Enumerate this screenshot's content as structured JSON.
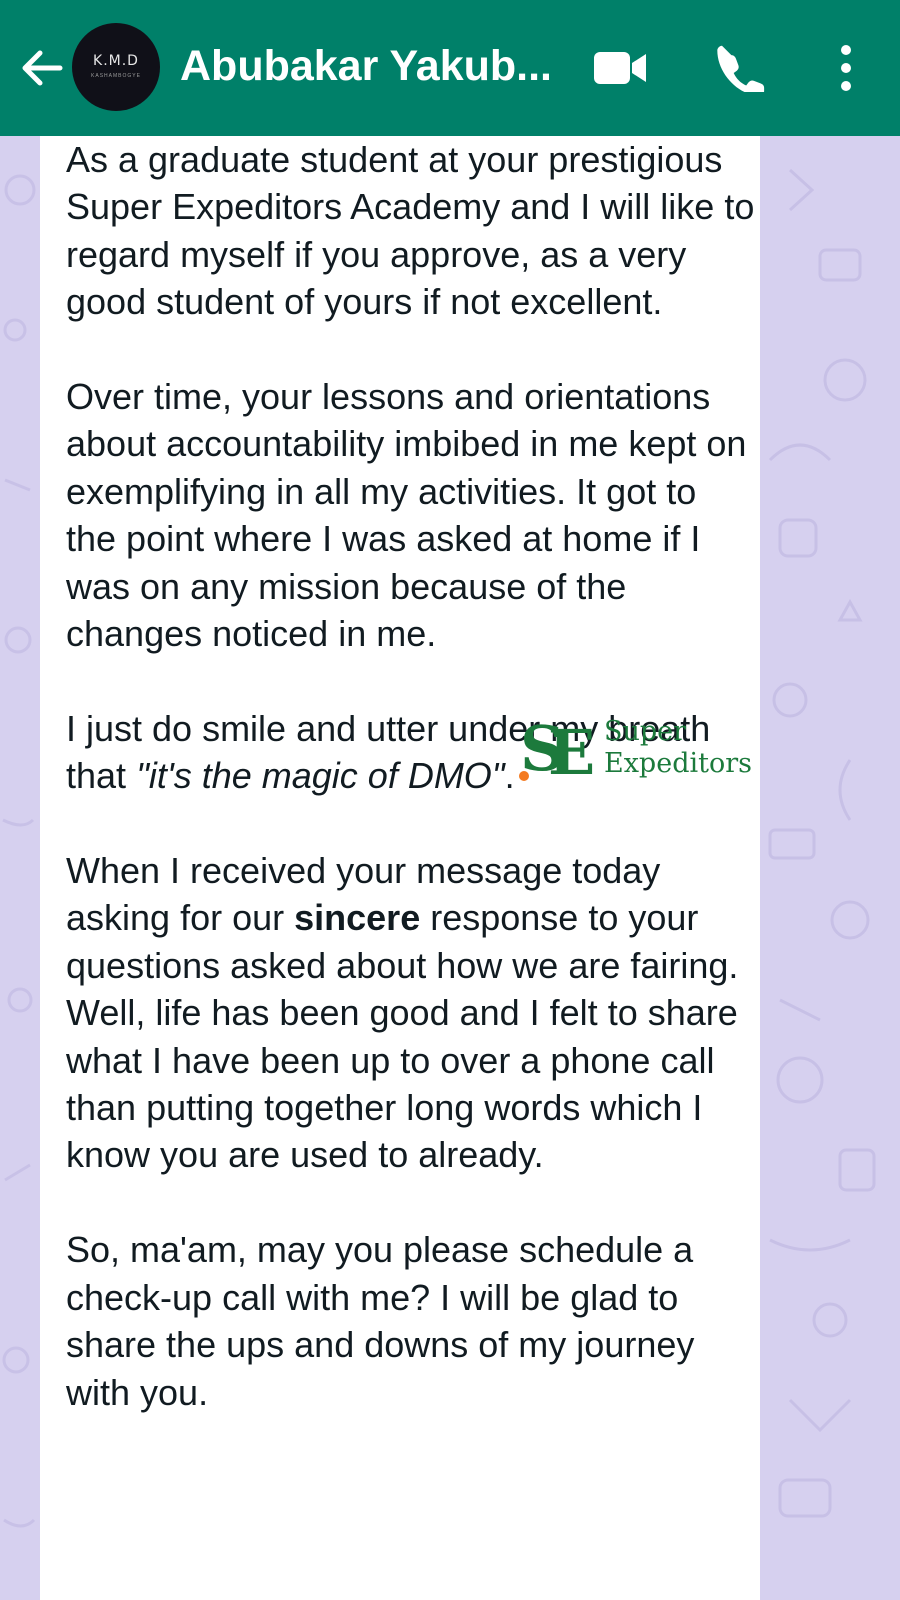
{
  "header": {
    "contact_name": "Abubakar Yakub...",
    "avatar_text": "K.M.D",
    "avatar_subtext": "KASHAMBOGYE",
    "back_icon": "arrow-left-icon",
    "video_icon": "video-camera-icon",
    "call_icon": "phone-icon",
    "menu_icon": "more-vertical-icon",
    "bar_color": "#008069"
  },
  "message": {
    "p1": "As a graduate student at your prestigious Super Expeditors Academy and I will like to regard myself if you approve, as a very good student of yours if not excellent.",
    "p2": "Over time, your lessons and orientations about accountability imbibed in me kept on exemplifying in all my activities. It got to the point where I was asked at home if I was on any mission because of the changes noticed in me.",
    "p3_before": "I just do smile and utter under my breath that ",
    "p3_italic": "\"it's the magic of DMO\"",
    "p3_after": ".",
    "p4_before": "When I received your message today asking for our ",
    "p4_bold": "sincere",
    "p4_after": " response to your questions asked about how we are fairing. Well, life has been good and I felt to share what I have been up to over a phone call than putting together long words which I know you are used to already.",
    "p5": "So, ma'am, may you please schedule a check-up call with me? I will be glad to share the ups and downs of my journey with you."
  },
  "watermark": {
    "mark": "SE",
    "line1": "Super",
    "line2": "Expeditors",
    "brand_color": "#1c7a3c",
    "accent_color": "#f47a20"
  },
  "colors": {
    "wallpaper": "#d6d0ef",
    "bubble": "#ffffff",
    "text": "#111b21"
  }
}
